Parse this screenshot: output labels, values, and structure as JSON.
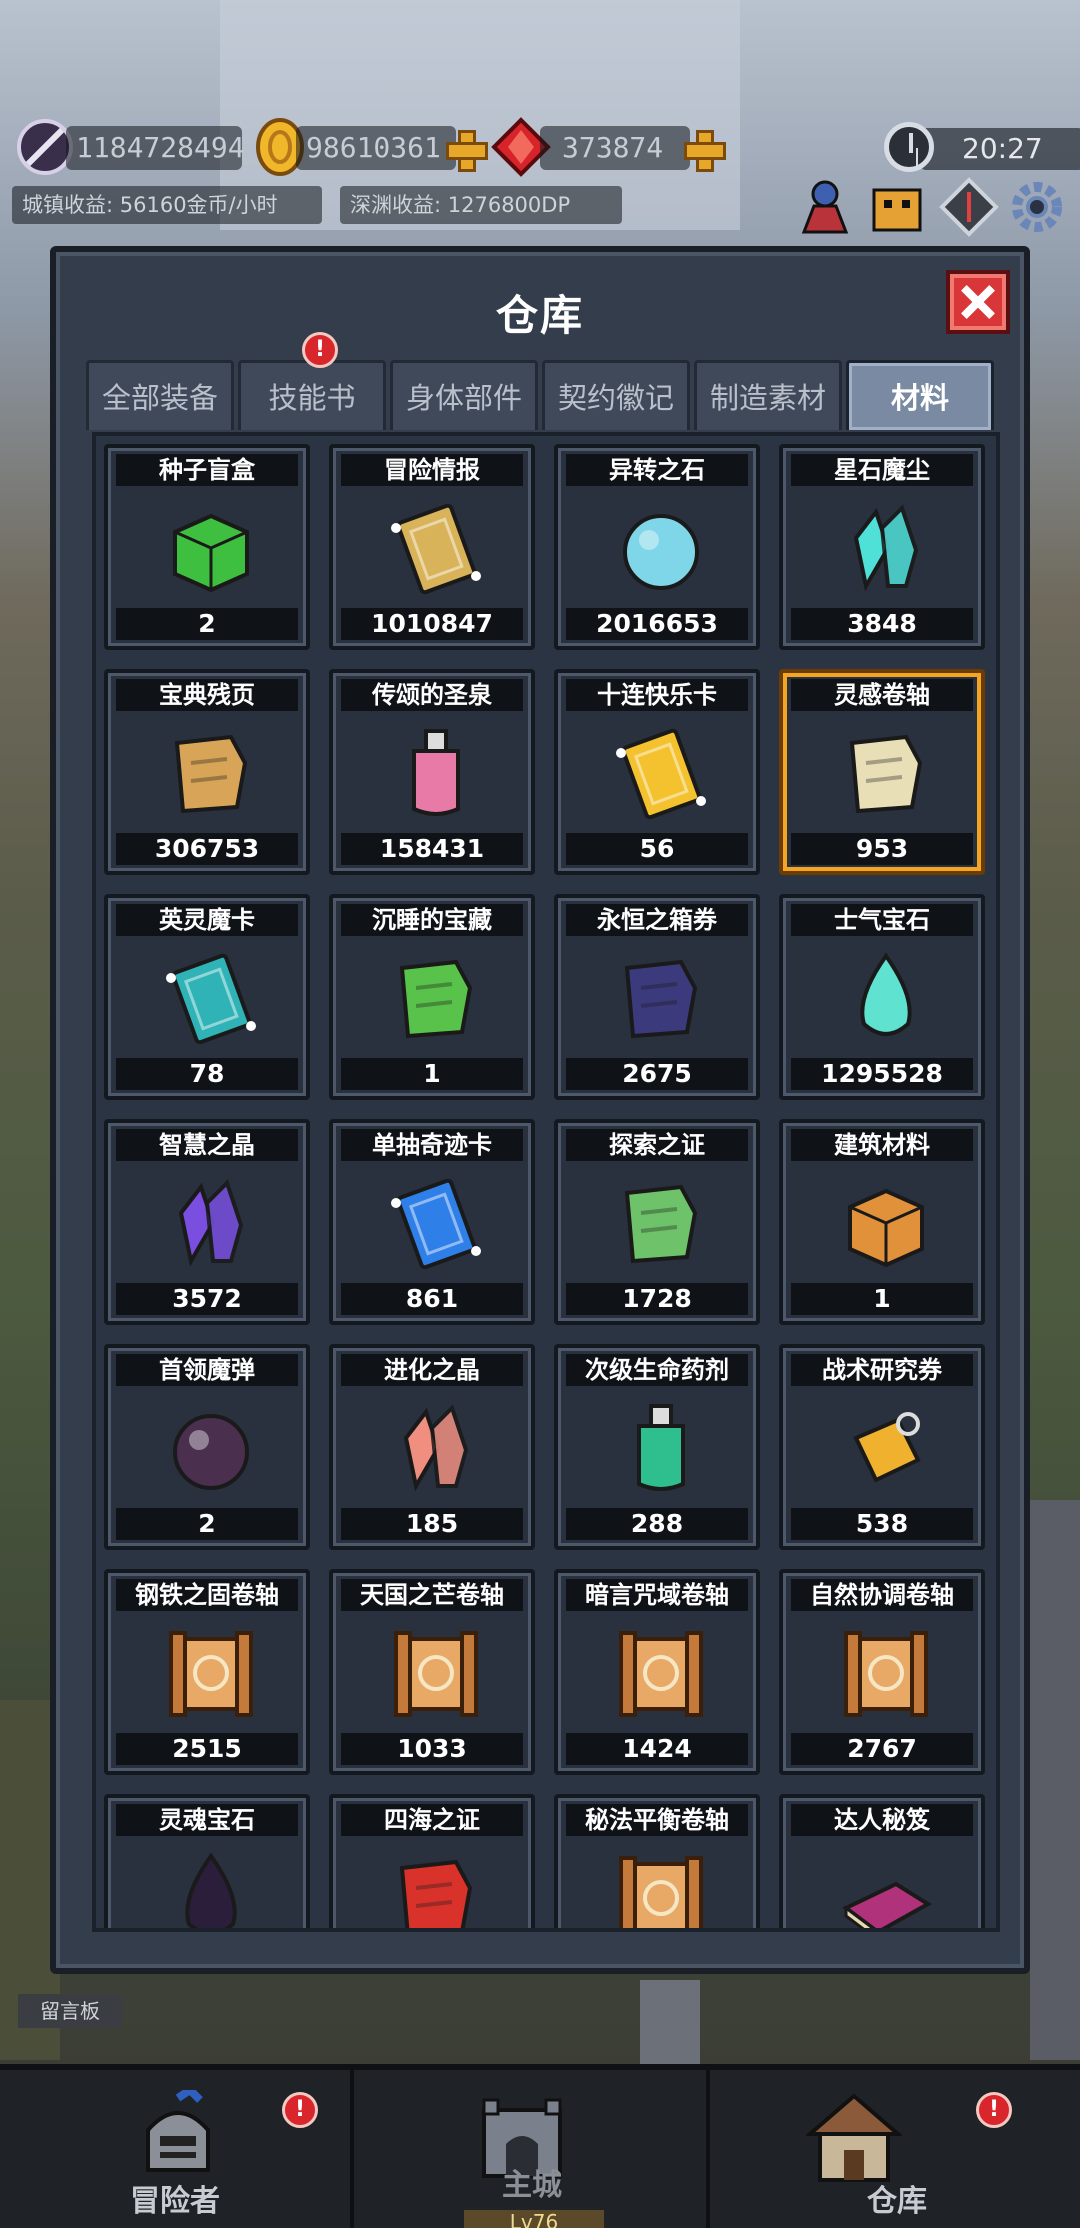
{
  "top": {
    "power": "1184728494",
    "gold": "98610361",
    "gems": "373874",
    "time": "20:27",
    "town_income": "城镇收益: 56160金币/小时",
    "abyss_income": "深渊收益: 1276800DP"
  },
  "panel": {
    "title": "仓库",
    "tabs": [
      {
        "label": "全部装备"
      },
      {
        "label": "技能书",
        "alert": "!"
      },
      {
        "label": "身体部件"
      },
      {
        "label": "契约徽记"
      },
      {
        "label": "制造素材"
      },
      {
        "label": "材料",
        "active": true
      }
    ]
  },
  "items": [
    {
      "name": "种子盲盒",
      "qty": "2",
      "icon": "gift-box-icon",
      "color": "#3fbf3f"
    },
    {
      "name": "冒险情报",
      "qty": "1010847",
      "icon": "cardboard-box-icon",
      "color": "#d9b35a"
    },
    {
      "name": "异转之石",
      "qty": "2016653",
      "icon": "prism-orb-icon",
      "color": "#7fd6e8"
    },
    {
      "name": "星石魔尘",
      "qty": "3848",
      "icon": "crystal-dust-icon",
      "color": "#4fe0d8"
    },
    {
      "name": "宝典残页",
      "qty": "306753",
      "icon": "torn-page-icon",
      "color": "#d8a558"
    },
    {
      "name": "传颂的圣泉",
      "qty": "158431",
      "icon": "potion-flask-icon",
      "color": "#e87aa8"
    },
    {
      "name": "十连快乐卡",
      "qty": "56",
      "icon": "gold-card-icon",
      "color": "#f4c22e"
    },
    {
      "name": "灵感卷轴",
      "qty": "953",
      "icon": "horn-scroll-icon",
      "color": "#e9dfb7",
      "selected": true
    },
    {
      "name": "英灵魔卡",
      "qty": "78",
      "icon": "teal-card-icon",
      "color": "#2fb3b6"
    },
    {
      "name": "沉睡的宝藏",
      "qty": "1",
      "icon": "green-sack-icon",
      "color": "#59c24a"
    },
    {
      "name": "永恒之箱券",
      "qty": "2675",
      "icon": "dark-scroll-icon",
      "color": "#3b3a7c"
    },
    {
      "name": "士气宝石",
      "qty": "1295528",
      "icon": "teardrop-gem-icon",
      "color": "#5fe2cf"
    },
    {
      "name": "智慧之晶",
      "qty": "3572",
      "icon": "purple-crystal-icon",
      "color": "#7a4fe0"
    },
    {
      "name": "单抽奇迹卡",
      "qty": "861",
      "icon": "blue-card-icon",
      "color": "#2f7fe8"
    },
    {
      "name": "探索之证",
      "qty": "1728",
      "icon": "map-scroll-icon",
      "color": "#6ec26a"
    },
    {
      "name": "建筑材料",
      "qty": "1",
      "icon": "brick-block-icon",
      "color": "#e0913a"
    },
    {
      "name": "首领魔弹",
      "qty": "2",
      "icon": "bomb-icon",
      "color": "#4a2f4f"
    },
    {
      "name": "进化之晶",
      "qty": "185",
      "icon": "pink-crystal-icon",
      "color": "#f08f80"
    },
    {
      "name": "次级生命药剂",
      "qty": "288",
      "icon": "green-vial-icon",
      "color": "#2fbf8f"
    },
    {
      "name": "战术研究券",
      "qty": "538",
      "icon": "gold-tag-icon",
      "color": "#f0b22e"
    },
    {
      "name": "钢铁之固卷轴",
      "qty": "2515",
      "icon": "scroll-steel-icon",
      "color": "#e8a866"
    },
    {
      "name": "天国之芒卷轴",
      "qty": "1033",
      "icon": "scroll-heaven-icon",
      "color": "#e8a866"
    },
    {
      "name": "暗言咒域卷轴",
      "qty": "1424",
      "icon": "scroll-dark-icon",
      "color": "#e8a866"
    },
    {
      "name": "自然协调卷轴",
      "qty": "2767",
      "icon": "scroll-nature-icon",
      "color": "#e8a866"
    },
    {
      "name": "灵魂宝石",
      "qty": "",
      "icon": "soul-gem-icon",
      "color": "#2a1e3a"
    },
    {
      "name": "四海之证",
      "qty": "",
      "icon": "red-ribbon-paper-icon",
      "color": "#d8322a"
    },
    {
      "name": "秘法平衡卷轴",
      "qty": "",
      "icon": "scroll-arcane-icon",
      "color": "#e8a866"
    },
    {
      "name": "达人秘笈",
      "qty": "",
      "icon": "magenta-book-icon",
      "color": "#b0327a"
    }
  ],
  "bottom": {
    "nav": [
      {
        "label": "冒险者",
        "icon": "knight-helmet-icon",
        "alert": "!"
      },
      {
        "label": "主城",
        "icon": "castle-gate-icon",
        "level": "Lv76"
      },
      {
        "label": "仓库",
        "icon": "house-icon",
        "alert": "!"
      }
    ],
    "board": "留言板"
  }
}
